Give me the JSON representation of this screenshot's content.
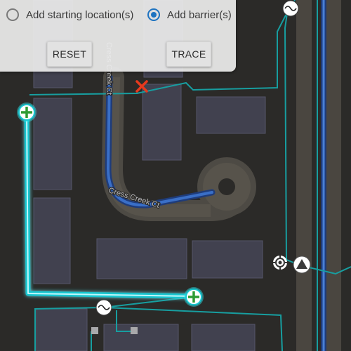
{
  "controls": {
    "starting_location_label": "Add starting location(s)",
    "barrier_label": "Add barrier(s)",
    "selected": "barrier",
    "reset_label": "RESET",
    "trace_label": "TRACE"
  },
  "map": {
    "street_names": [
      "Cress Creek Ct",
      "Cress Creek Ct"
    ],
    "colors": {
      "background": "#2b2a28",
      "buildings": "#41414f",
      "network_lines": "#179ea0",
      "trace_highlight": "#2ee6ee",
      "selected_line": "#2f5fb4",
      "barrier": "#e8391d",
      "start_marker": "#2e9b33",
      "accent": "#1e73c0"
    },
    "icons": [
      "barrier-x-icon",
      "starting-point-icon",
      "transformer-icon",
      "triangle-device-icon",
      "location-target-icon"
    ]
  }
}
